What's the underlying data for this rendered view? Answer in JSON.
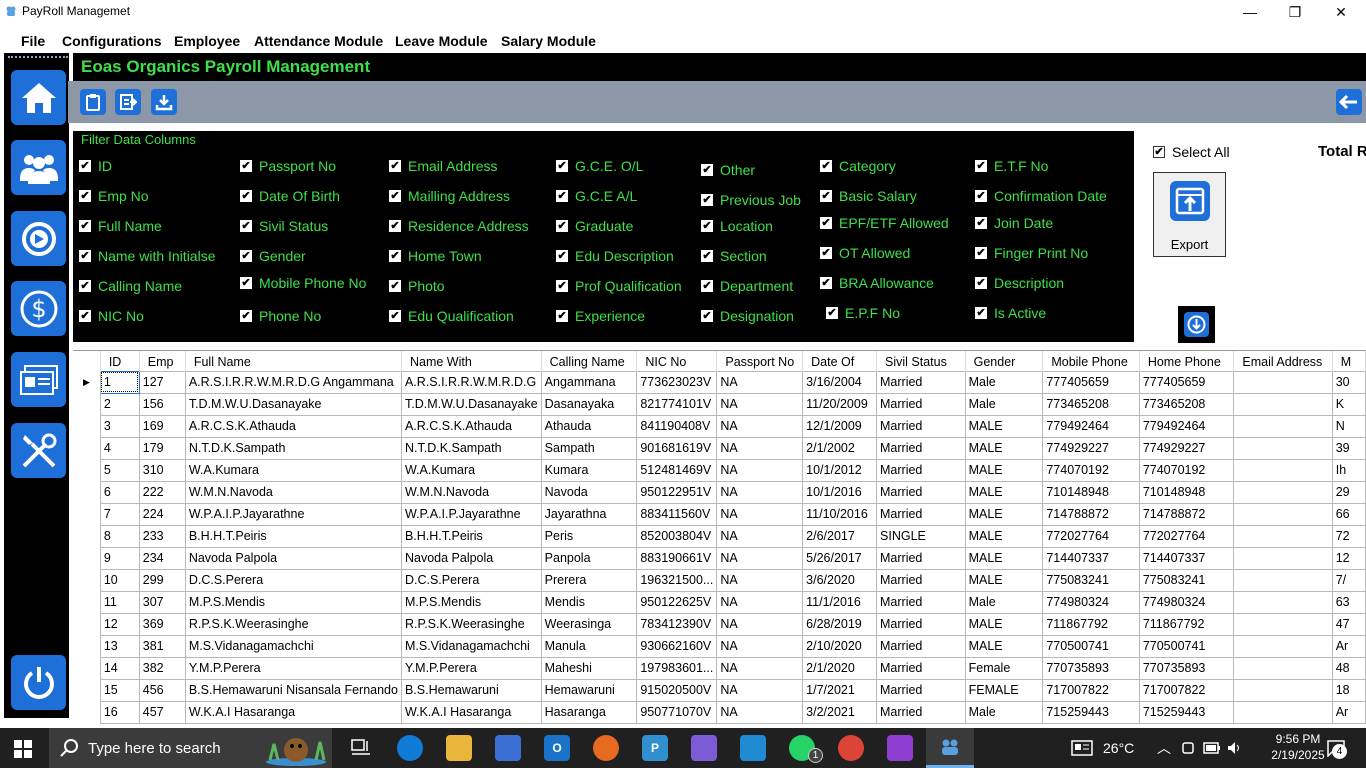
{
  "window": {
    "title": "PayRoll Managemet",
    "minimize": "—",
    "maximize": "❐",
    "close": "✕"
  },
  "menu": [
    "File",
    "Configurations",
    "Employee",
    "Attendance Module",
    "Leave Module",
    "Salary Module"
  ],
  "header": {
    "title": "Eoas Organics Payroll Management"
  },
  "filter": {
    "legend": "Filter Data Columns",
    "columns": [
      [
        "ID",
        "Emp No",
        "Full Name",
        "Name with Initialse",
        "Calling Name",
        "NIC No"
      ],
      [
        "Passport No",
        "Date Of Birth",
        "Sivil Status",
        "Gender",
        "Mobile Phone No",
        "Phone No"
      ],
      [
        "Email Address",
        "Mailling Address",
        "Residence Address",
        "Home Town",
        "Photo",
        "Edu Qualification"
      ],
      [
        "G.C.E. O/L",
        "G.C.E A/L",
        "Graduate",
        "Edu Description",
        "Prof Qualification",
        "Experience"
      ],
      [
        "Other",
        "Previous Job",
        "Location",
        "Section",
        "Department",
        "Designation"
      ],
      [
        "Category",
        "Basic Salary",
        "EPF/ETF Allowed",
        "OT Allowed",
        "BRA Allowance",
        "E.P.F No"
      ],
      [
        "E.T.F No",
        "Confirmation Date",
        "Join Date",
        "Finger Print No",
        "Description",
        "Is Active"
      ]
    ],
    "check_mark": "✔"
  },
  "select_all": "Select All",
  "total_label": "Total R",
  "export_label": "Export",
  "grid": {
    "headers": [
      "ID",
      "Emp",
      "Full Name",
      "Name With",
      "Calling Name",
      "NIC No",
      "Passport No",
      "Date Of",
      "Sivil Status",
      "Gender",
      "Mobile Phone",
      "Home Phone",
      "Email Address",
      "M"
    ],
    "row_pointer": "▶",
    "rows": [
      [
        "1",
        "127",
        "A.R.S.I.R.R.W.M.R.D.G Angammana",
        "A.R.S.I.R.R.W.M.R.D.G",
        "Angammana",
        "773623023V",
        "NA",
        "3/16/2004",
        "Married",
        "Male",
        "777405659",
        "777405659",
        "",
        "30"
      ],
      [
        "2",
        "156",
        "T.D.M.W.U.Dasanayake",
        "T.D.M.W.U.Dasanayake",
        "Dasanayaka",
        "821774101V",
        "NA",
        "11/20/2009",
        "Married",
        "Male",
        "773465208",
        "773465208",
        "",
        "K"
      ],
      [
        "3",
        "169",
        "A.R.C.S.K.Athauda",
        "A.R.C.S.K.Athauda",
        "Athauda",
        "841190408V",
        "NA",
        "12/1/2009",
        "Married",
        "MALE",
        "779492464",
        "779492464",
        "",
        "N"
      ],
      [
        "4",
        "179",
        "N.T.D.K.Sampath",
        "N.T.D.K.Sampath",
        "Sampath",
        "901681619V",
        "NA",
        "2/1/2002",
        "Married",
        "MALE",
        "774929227",
        "774929227",
        "",
        "39"
      ],
      [
        "5",
        "310",
        "W.A.Kumara",
        "W.A.Kumara",
        "Kumara",
        "512481469V",
        "NA",
        "10/1/2012",
        "Married",
        "MALE",
        "774070192",
        "774070192",
        "",
        "Ih"
      ],
      [
        "6",
        "222",
        "W.M.N.Navoda",
        "W.M.N.Navoda",
        "Navoda",
        "950122951V",
        "NA",
        "10/1/2016",
        "Married",
        "MALE",
        "710148948",
        "710148948",
        "",
        "29"
      ],
      [
        "7",
        "224",
        "W.P.A.I.P.Jayarathne",
        "W.P.A.I.P.Jayarathne",
        "Jayarathna",
        "883411560V",
        "NA",
        "11/10/2016",
        "Married",
        "MALE",
        "714788872",
        "714788872",
        "",
        "66"
      ],
      [
        "8",
        "233",
        " B.H.H.T.Peiris",
        " B.H.H.T.Peiris",
        "Peris",
        "852003804V",
        "NA",
        "2/6/2017",
        "SINGLE",
        "MALE",
        "772027764",
        "772027764",
        "",
        "72"
      ],
      [
        "9",
        "234",
        "Navoda Palpola",
        "Navoda Palpola",
        "Panpola",
        "883190661V",
        "NA",
        "5/26/2017",
        "Married",
        "MALE",
        "714407337",
        "714407337",
        "",
        "12"
      ],
      [
        "10",
        "299",
        "D.C.S.Perera",
        "D.C.S.Perera",
        "Prerera",
        "196321500...",
        "NA",
        "3/6/2020",
        "Married",
        "MALE",
        "775083241",
        "775083241",
        "",
        "7/"
      ],
      [
        "11",
        "307",
        "M.P.S.Mendis",
        "M.P.S.Mendis",
        "Mendis",
        "950122625V",
        "NA",
        "11/1/2016",
        "Married",
        "Male",
        "774980324",
        "774980324",
        "",
        "63"
      ],
      [
        "12",
        "369",
        "R.P.S.K.Weerasinghe",
        "R.P.S.K.Weerasinghe",
        "Weerasinga",
        "783412390V",
        "NA",
        "6/28/2019",
        "Married",
        "MALE",
        "711867792",
        "711867792",
        "",
        "47"
      ],
      [
        "13",
        "381",
        "M.S.Vidanagamachchi",
        "M.S.Vidanagamachchi",
        "Manula",
        "930662160V",
        "NA",
        "2/10/2020",
        "Married",
        "MALE",
        "770500741",
        "770500741",
        "",
        "Ar"
      ],
      [
        "14",
        "382",
        "Y.M.P.Perera",
        "Y.M.P.Perera",
        "Maheshi",
        "197983601...",
        "NA",
        "2/1/2020",
        "Married",
        "Female",
        "770735893",
        "770735893",
        "",
        "48"
      ],
      [
        "15",
        "456",
        "B.S.Hemawaruni Nisansala Fernando",
        "B.S.Hemawaruni",
        "Hemawaruni",
        "915020500V",
        "NA",
        "1/7/2021",
        "Married",
        "FEMALE",
        "717007822",
        "717007822",
        "",
        "18"
      ],
      [
        "16",
        "457",
        "W.K.A.I Hasaranga",
        "W.K.A.I Hasaranga",
        "Hasaranga",
        "950771070V",
        "NA",
        "3/2/2021",
        "Married",
        "Male",
        "715259443",
        "715259443",
        "",
        "Ar"
      ]
    ]
  },
  "taskbar": {
    "search_placeholder": "Type here to search",
    "weather": "26°C",
    "time": "9:56 PM",
    "date": "2/19/2025",
    "notification_count": "4",
    "whatsapp_badge": "1"
  }
}
